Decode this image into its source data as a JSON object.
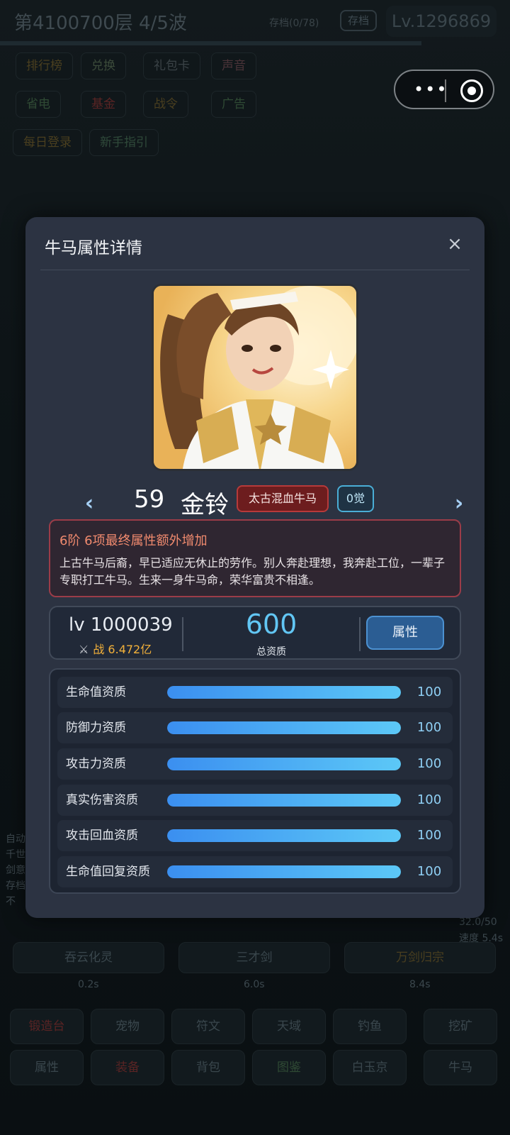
{
  "background": {
    "floor_text": "第4100700层  4/5波",
    "save_note": "存档(0/78)",
    "save_button": "存档",
    "level": "Lv.1296869",
    "menu_row1": [
      "排行榜",
      "兑换",
      "礼包卡",
      "声音"
    ],
    "menu_row2": [
      "省电",
      "基金",
      "战令",
      "广告"
    ],
    "menu_row3": [
      "每日登录",
      "新手指引"
    ],
    "side_texts": [
      "自动",
      "千世",
      "剑意",
      "存档",
      "不"
    ],
    "stat_right": "32.0/50",
    "stat_right2": "速度 5.4s",
    "action_buttons": [
      "吞云化灵",
      "三才剑",
      "万剑归宗"
    ],
    "action_timers": [
      "0.2s",
      "6.0s",
      "8.4s"
    ],
    "nav_row1": [
      "锻造台",
      "宠物",
      "符文",
      "天域",
      "钓鱼",
      "挖矿"
    ],
    "nav_row2": [
      "属性",
      "装备",
      "背包",
      "图鉴",
      "白玉京",
      "牛马"
    ]
  },
  "modal": {
    "title": "牛马属性详情",
    "close_icon": "×",
    "prev_icon": "‹",
    "next_icon": "›",
    "character": {
      "number": "59",
      "name": "金铃",
      "tier_badge": "太古混血牛马",
      "awaken_badge": "0觉"
    },
    "description": {
      "headline": "6阶  6项最终属性额外增加",
      "text": "上古牛马后裔，早已适应无休止的劳作。别人奔赴理想，我奔赴工位，一辈子专职打工牛马。生来一身牛马命，荣华富贵不相逢。"
    },
    "stats": {
      "level": "lv 1000039",
      "power_icon": "⚔",
      "power": "战 6.472亿",
      "total_value": "600",
      "total_label": "总资质",
      "attr_button": "属性"
    },
    "attributes": [
      {
        "name": "生命值资质",
        "value": "100",
        "fill": 100
      },
      {
        "name": "防御力资质",
        "value": "100",
        "fill": 100
      },
      {
        "name": "攻击力资质",
        "value": "100",
        "fill": 100
      },
      {
        "name": "真实伤害资质",
        "value": "100",
        "fill": 100
      },
      {
        "name": "攻击回血资质",
        "value": "100",
        "fill": 100
      },
      {
        "name": "生命值回复资质",
        "value": "100",
        "fill": 100
      }
    ]
  },
  "colors": {
    "modal_bg": "#2c3342",
    "accent_blue": "#62c6f4",
    "tier_red": "#b73a3a",
    "power_gold": "#f3b13a"
  }
}
